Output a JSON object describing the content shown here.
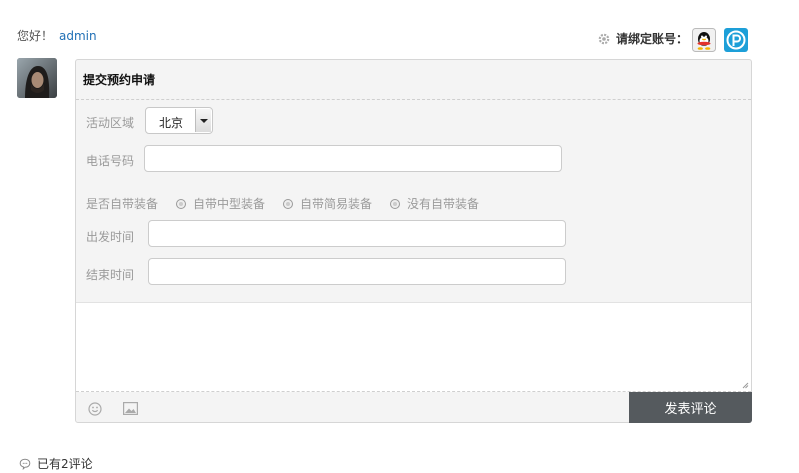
{
  "header": {
    "greeting": "您好！",
    "username": "admin",
    "bind_text": "请绑定账号："
  },
  "form": {
    "title": "提交预约申请",
    "area_label": "活动区域",
    "area_value": "北京",
    "phone_label": "电话号码",
    "equipment_label": "是否自带装备",
    "equipment_options": [
      "自带中型装备",
      "自带简易装备",
      "没有自带装备"
    ],
    "depart_label": "出发时间",
    "end_label": "结束时间",
    "submit_label": "发表评论"
  },
  "footer": {
    "comment_count": "已有2评论"
  },
  "colors": {
    "link": "#1f6fb5",
    "submit_bg": "#555a5e",
    "panel_bg": "#f4f4f4"
  }
}
